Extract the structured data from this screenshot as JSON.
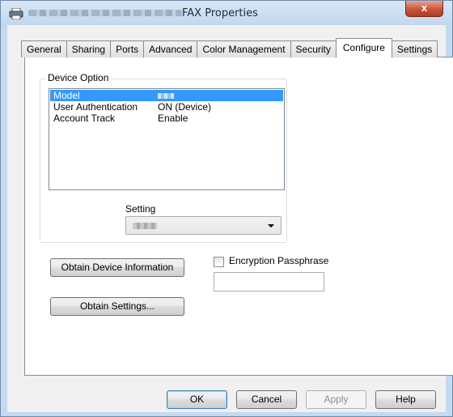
{
  "window": {
    "title": "FAX Properties",
    "close_label": "x"
  },
  "tabs": [
    {
      "label": "General"
    },
    {
      "label": "Sharing"
    },
    {
      "label": "Ports"
    },
    {
      "label": "Advanced"
    },
    {
      "label": "Color Management"
    },
    {
      "label": "Security"
    },
    {
      "label": "Configure",
      "active": true
    },
    {
      "label": "Settings"
    }
  ],
  "device_option": {
    "group_label": "Device Option",
    "rows": [
      {
        "key": "Model",
        "value": "",
        "selected": true
      },
      {
        "key": "User Authentication",
        "value": "ON (Device)"
      },
      {
        "key": "Account Track",
        "value": "Enable"
      }
    ],
    "setting_label": "Setting",
    "setting_value": ""
  },
  "buttons": {
    "obtain_device_info": "Obtain Device Information",
    "obtain_settings": "Obtain Settings...",
    "ok": "OK",
    "cancel": "Cancel",
    "apply": "Apply",
    "help": "Help"
  },
  "encryption": {
    "label": "Encryption Passphrase",
    "checked": false,
    "value": ""
  },
  "colors": {
    "selection": "#3399ff",
    "frame": "#c5d9ef",
    "close_button": "#c7543a"
  }
}
